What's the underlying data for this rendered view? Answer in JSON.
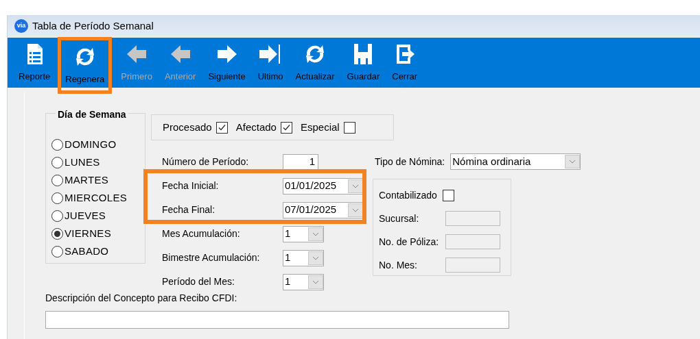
{
  "window": {
    "app_icon_text": "via",
    "title": "Tabla de Período Semanal"
  },
  "toolbar": [
    {
      "label": "Reporte",
      "kind": "report",
      "disabled": false,
      "highlighted": false
    },
    {
      "label": "Regenera",
      "kind": "refresh",
      "disabled": false,
      "highlighted": true
    },
    {
      "label": "Primero",
      "kind": "first",
      "disabled": true,
      "highlighted": false
    },
    {
      "label": "Anterior",
      "kind": "previous",
      "disabled": true,
      "highlighted": false
    },
    {
      "label": "Siguiente",
      "kind": "next",
      "disabled": false,
      "highlighted": false
    },
    {
      "label": "Ultimo",
      "kind": "last",
      "disabled": false,
      "highlighted": false
    },
    {
      "label": "Actualizar",
      "kind": "refresh",
      "disabled": false,
      "highlighted": false
    },
    {
      "label": "Guardar",
      "kind": "save",
      "disabled": false,
      "highlighted": false
    },
    {
      "label": "Cerrar",
      "kind": "exit",
      "disabled": false,
      "highlighted": false
    }
  ],
  "weekday_group": {
    "title": "Día de Semana",
    "options": [
      {
        "label": "DOMINGO",
        "selected": false
      },
      {
        "label": "LUNES",
        "selected": false
      },
      {
        "label": "MARTES",
        "selected": false
      },
      {
        "label": "MIERCOLES",
        "selected": false
      },
      {
        "label": "JUEVES",
        "selected": false
      },
      {
        "label": "VIERNES",
        "selected": true
      },
      {
        "label": "SABADO",
        "selected": false
      }
    ]
  },
  "flags": [
    {
      "label": "Procesado",
      "checked": true
    },
    {
      "label": "Afectado",
      "checked": true
    },
    {
      "label": "Especial",
      "checked": false
    }
  ],
  "fields": [
    {
      "label": "Número de Período:",
      "kind": "number",
      "value": "1",
      "highlighted": false
    },
    {
      "label": "Fecha Inicial:",
      "kind": "date",
      "value": "01/01/2025",
      "highlighted": true
    },
    {
      "label": "Fecha Final:",
      "kind": "date",
      "value": "07/01/2025",
      "highlighted": true
    },
    {
      "label": "Mes Acumulación:",
      "kind": "combo",
      "value": "1",
      "highlighted": false
    },
    {
      "label": "Bimestre Acumulación:",
      "kind": "combo",
      "value": "1",
      "highlighted": false
    },
    {
      "label": "Período del Mes:",
      "kind": "combo",
      "value": "1",
      "highlighted": false
    }
  ],
  "payroll_type": {
    "label": "Tipo de Nómina:",
    "value": "Nómina ordinaria"
  },
  "accounting": {
    "checkbox": {
      "label": "Contabilizado",
      "checked": false
    },
    "fields": [
      {
        "label": "Sucursal:"
      },
      {
        "label": "No. de Póliza:"
      },
      {
        "label": "No. Mes:"
      }
    ]
  },
  "description": {
    "label": "Descripción del Concepto para Recibo CFDI:"
  }
}
